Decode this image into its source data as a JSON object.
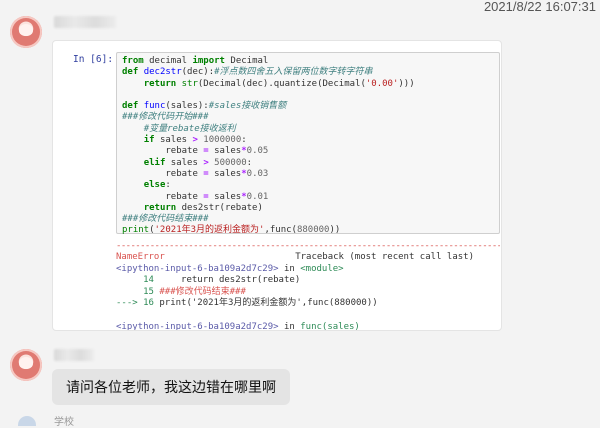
{
  "timestamp": "2021/8/22 16:07:31",
  "notebook": {
    "prompt": "In  [6]:",
    "code": {
      "l1_kw1": "from",
      "l1_mod": " decimal ",
      "l1_kw2": "import",
      "l1_name": " Decimal",
      "l2_kw": "def",
      "l2_fn": "dec2str",
      "l2_args": "(dec):",
      "l2_cm": "#浮点数四舍五入保留两位数字转字符串",
      "l3_kw": "return",
      "l3_b": "str",
      "l3_a": "(Decimal(dec).quantize(Decimal(",
      "l3_s": "'0.00'",
      "l3_e": ")))",
      "l5_kw": "def",
      "l5_fn": "func",
      "l5_args": "(sales):",
      "l5_cm": "#sales接收销售额",
      "l6_cm": "###修改代码开始###",
      "l7_cm": "#变量rebate接收返利",
      "l8_kw": "if",
      "l8_a": " sales ",
      "l8_op": ">",
      "l8_n": " 1000000",
      "l8_e": ":",
      "l9_a": "rebate ",
      "l9_op1": "=",
      "l9_b": " sales",
      "l9_op2": "*",
      "l9_n": "0.05",
      "l10_kw": "elif",
      "l10_a": " sales ",
      "l10_op": ">",
      "l10_n": " 500000",
      "l10_e": ":",
      "l11_a": "rebate ",
      "l11_op1": "=",
      "l11_b": " sales",
      "l11_op2": "*",
      "l11_n": "0.03",
      "l12_kw": "else",
      "l12_e": ":",
      "l13_a": "rebate ",
      "l13_op1": "=",
      "l13_b": " sales",
      "l13_op2": "*",
      "l13_n": "0.01",
      "l14_kw": "return",
      "l14_a": " des2str(rebate)",
      "l15_cm": "###修改代码结束###",
      "l16_b": "print",
      "l16_a": "(",
      "l16_s": "'2021年3月的返利金额为'",
      "l16_m": ",func(",
      "l16_n": "880000",
      "l16_e": "))"
    },
    "output": {
      "separator": "----------------------------------------------------------------------------------------------",
      "error_name": "NameError",
      "traceback_label": "Traceback (most recent call last)",
      "o2_a": "<ipython-input-6-ba109a2d7c29>",
      "o2_b": " in ",
      "o2_c": "<module>",
      "o3_n": "14",
      "o3_t": "     return des2str(rebate)",
      "o4_n": "15",
      "o4_t": " ###修改代码结束###",
      "o5_arrow": "---> ",
      "o5_n": "16",
      "o5_t": " print('2021年3月的返利金额为',func(880000))",
      "o7_a": "<ipython-input-6-ba109a2d7c29>",
      "o7_b": " in ",
      "o7_c": "func(sales)"
    }
  },
  "question": "请问各位老师，我这边错在哪里啊",
  "footer_name": "学校"
}
